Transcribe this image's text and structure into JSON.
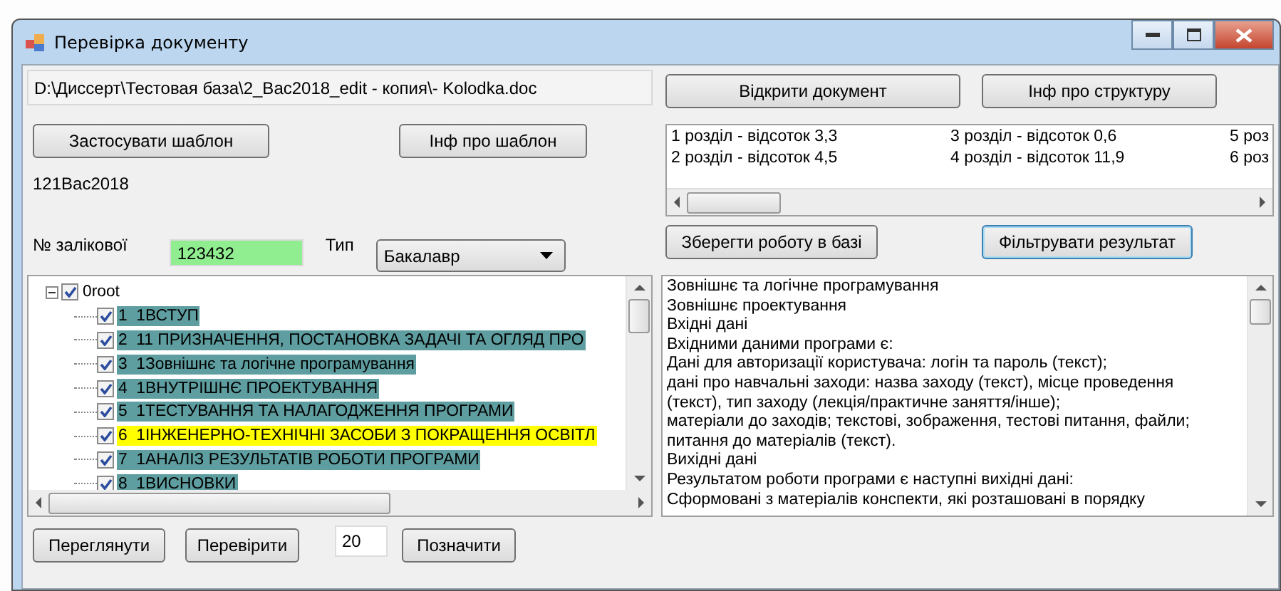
{
  "window": {
    "title": "Перевірка документу"
  },
  "file_path": {
    "value": "D:\\Диссерт\\Тестовая база\\2_Bac2018_edit - копия\\- Kolodka.doc"
  },
  "buttons_top": {
    "open": "Відкрити документ",
    "structure_info": "Інф про структуру",
    "apply_template": "Застосувати шаблон",
    "template_info": "Інф про шаблон"
  },
  "template_name": "121Bac2018",
  "section_percentages": [
    "1 розділ - відсоток 3,3",
    "2 розділ - відсоток 4,5",
    "3 розділ - відсоток 0,6",
    "4 розділ - відсоток 11,9",
    "5 роз",
    "6 роз"
  ],
  "record_book": {
    "label": "№ залікової",
    "value": "123432"
  },
  "type": {
    "label": "Тип",
    "value": "Бакалавр"
  },
  "buttons_middle": {
    "save": "Зберегти роботу в базі",
    "filter": "Фільтрувати результат"
  },
  "tree": {
    "label": "0root",
    "checked": true,
    "expanded": true,
    "children": [
      {
        "label": "1  1ВСТУП",
        "checked": true,
        "color": "#5f9ea0"
      },
      {
        "label": "2  11 ПРИЗНАЧЕННЯ, ПОСТАНОВКА ЗАДАЧІ ТА ОГЛЯД ПРО",
        "checked": true,
        "color": "#5f9ea0"
      },
      {
        "label": "3  1Зовнішнє та логічне програмування",
        "checked": true,
        "color": "#5f9ea0"
      },
      {
        "label": "4  1ВНУТРІШНЄ ПРОЕКТУВАННЯ",
        "checked": true,
        "color": "#5f9ea0"
      },
      {
        "label": "5  1ТЕСТУВАННЯ ТА НАЛАГОДЖЕННЯ ПРОГРАМИ",
        "checked": true,
        "color": "#5f9ea0"
      },
      {
        "label": "6  1ІНЖЕНЕРНО-ТЕХНІЧНІ ЗАСОБИ З ПОКРАЩЕННЯ ОСВІТЛ",
        "checked": true,
        "color": "#ffff00"
      },
      {
        "label": "7  1АНАЛІЗ РЕЗУЛЬТАТІВ РОБОТИ ПРОГРАМИ",
        "checked": true,
        "color": "#5f9ea0"
      },
      {
        "label": "8  1ВИСНОВКИ",
        "checked": true,
        "color": "#5f9ea0"
      }
    ]
  },
  "result_text": [
    "Зовнішнє та логічне програмування",
    "Зовнішнє проектування",
    "Вхідні дані",
    "Вхідними даними програми є:",
    "Дані для авторизації користувача: логін та пароль (текст);",
    "дані про навчальні заходи: назва заходу (текст), місце проведення",
    "(текст), тип заходу (лекція/практичне заняття/інше);",
    "матеріали до заходів; текстові, зображення, тестові питання, файли;",
    "питання до матеріалів (текст).",
    "Вихідні дані",
    "Результатом роботи програми є наступні вихідні дані:",
    "Сформовані з матеріалів конспекти, які розташовані в порядку"
  ],
  "buttons_bottom": {
    "view": "Переглянути",
    "check": "Перевірити",
    "count": "20",
    "mark": "Позначити"
  }
}
